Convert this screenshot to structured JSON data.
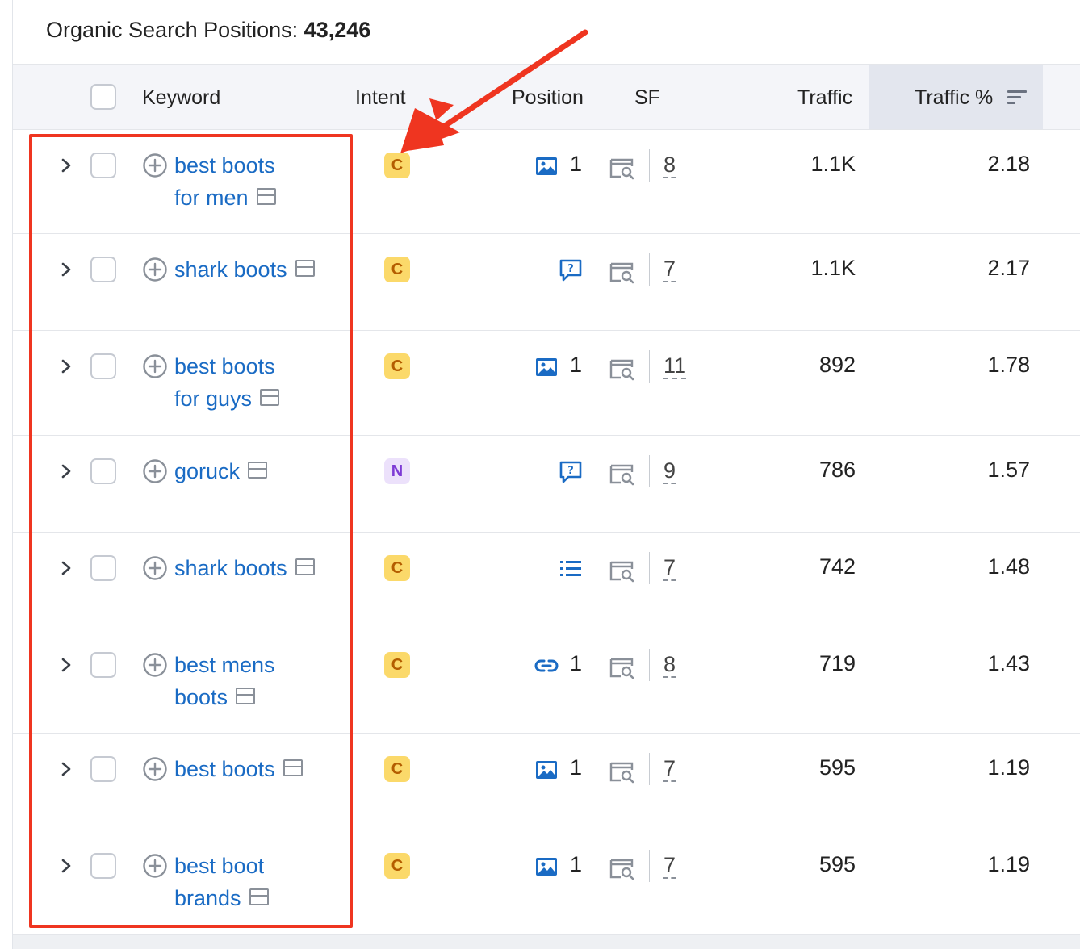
{
  "header": {
    "title_label": "Organic Search Positions:",
    "title_count": "43,246"
  },
  "columns": {
    "keyword": "Keyword",
    "intent": "Intent",
    "position": "Position",
    "sf": "SF",
    "traffic": "Traffic",
    "traffic_pct": "Traffic %"
  },
  "rows": [
    {
      "keyword_lines": [
        "best boots",
        "for men"
      ],
      "intent": "C",
      "feature_icon": "image-icon",
      "position": "1",
      "sf": "8",
      "traffic": "1.1K",
      "traffic_pct": "2.18"
    },
    {
      "keyword_lines": [
        "shark boots"
      ],
      "intent": "C",
      "feature_icon": "faq-icon",
      "position": "",
      "sf": "7",
      "traffic": "1.1K",
      "traffic_pct": "2.17"
    },
    {
      "keyword_lines": [
        "best boots",
        "for guys"
      ],
      "intent": "C",
      "feature_icon": "image-icon",
      "position": "1",
      "sf": "11",
      "traffic": "892",
      "traffic_pct": "1.78"
    },
    {
      "keyword_lines": [
        "goruck"
      ],
      "intent": "N",
      "feature_icon": "faq-icon",
      "position": "",
      "sf": "9",
      "traffic": "786",
      "traffic_pct": "1.57"
    },
    {
      "keyword_lines": [
        "shark boots"
      ],
      "intent": "C",
      "feature_icon": "list-icon",
      "position": "",
      "sf": "7",
      "traffic": "742",
      "traffic_pct": "1.48"
    },
    {
      "keyword_lines": [
        "best mens",
        "boots"
      ],
      "intent": "C",
      "feature_icon": "link-icon",
      "position": "1",
      "sf": "8",
      "traffic": "719",
      "traffic_pct": "1.43"
    },
    {
      "keyword_lines": [
        "best boots"
      ],
      "intent": "C",
      "feature_icon": "image-icon",
      "position": "1",
      "sf": "7",
      "traffic": "595",
      "traffic_pct": "1.19"
    },
    {
      "keyword_lines": [
        "best boot",
        "brands"
      ],
      "intent": "C",
      "feature_icon": "image-icon",
      "position": "1",
      "sf": "7",
      "traffic": "595",
      "traffic_pct": "1.19"
    }
  ],
  "colors": {
    "link": "#1a6bc4",
    "intent_commercial_bg": "#fbd96a",
    "intent_commercial_fg": "#b45d00",
    "intent_navigational_bg": "#ece1fb",
    "intent_navigational_fg": "#7e3bd5",
    "annotation_red": "#ef3520"
  }
}
